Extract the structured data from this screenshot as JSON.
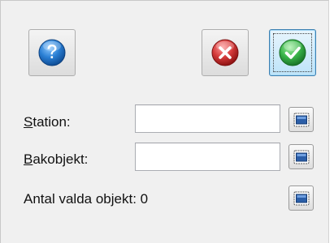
{
  "dialog": {
    "buttons": {
      "help_icon": "help-question-icon",
      "cancel_icon": "cancel-x-icon",
      "ok_icon": "ok-checkmark-icon"
    },
    "fields": [
      {
        "mnemonic": "S",
        "label_rest": "tation:",
        "value": "",
        "placeholder": ""
      },
      {
        "mnemonic": "B",
        "label_rest": "akobjekt:",
        "value": "",
        "placeholder": ""
      }
    ],
    "selected_count_label": "Antal valda objekt: 0",
    "pick_button_icon": "select-window-icon"
  },
  "colors": {
    "help": "#2a7fd4",
    "cancel": "#d43a3a",
    "ok": "#3ab54a",
    "focus_border": "#3c7fb1",
    "pick_icon": "#2b5ea8"
  }
}
